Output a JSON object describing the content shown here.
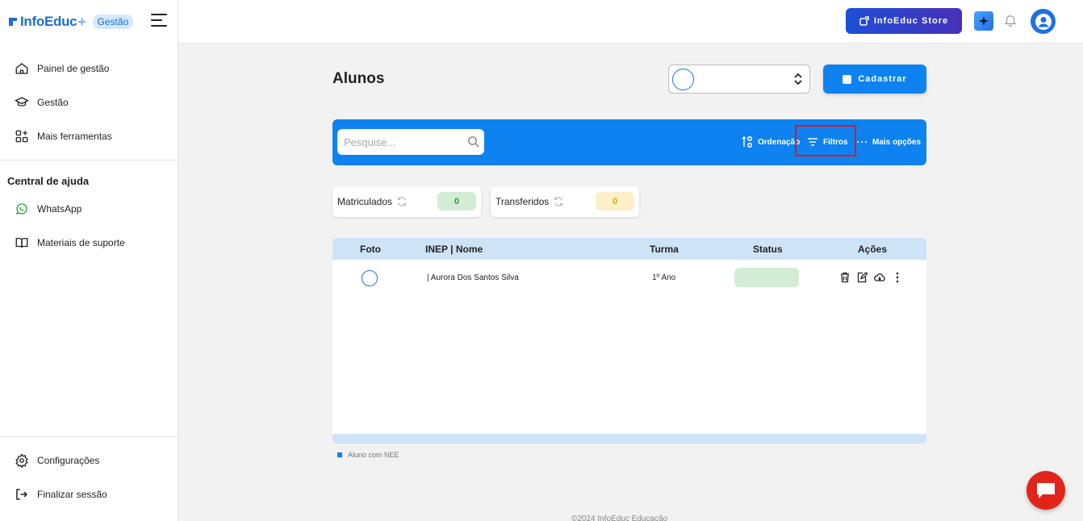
{
  "brand": {
    "name": "InfoEduc",
    "badge": "Gestão"
  },
  "sidebar": {
    "items": [
      {
        "label": "Painel de gestão",
        "icon": "home-icon"
      },
      {
        "label": "Gestão",
        "icon": "graduation-cap-icon"
      },
      {
        "label": "Mais ferramentas",
        "icon": "apps-icon"
      }
    ],
    "help_title": "Central de ajuda",
    "help_items": [
      {
        "label": "WhatsApp",
        "icon": "whatsapp-icon"
      },
      {
        "label": "Materiais de suporte",
        "icon": "book-icon"
      }
    ],
    "bottom_items": [
      {
        "label": "Configurações",
        "icon": "gear-icon"
      },
      {
        "label": "Finalizar sessão",
        "icon": "logout-icon"
      }
    ]
  },
  "topbar": {
    "store_label": "InfoEduc Store"
  },
  "page": {
    "title": "Alunos",
    "cadastrar_label": "Cadastrar"
  },
  "toolbar": {
    "search_placeholder": "Pesquise...",
    "ordenacao": "Ordenação",
    "filtros": "Filtros",
    "mais_opcoes": "Mais opções"
  },
  "stats": {
    "matriculados": {
      "label": "Matriculados",
      "value": "0"
    },
    "transferidos": {
      "label": "Transferidos",
      "value": "0"
    }
  },
  "table": {
    "columns": [
      "Foto",
      "INEP | Nome",
      "Turma",
      "Status",
      "Ações"
    ],
    "rows": [
      {
        "nome": "| Aurora Dos Santos Silva",
        "turma": "1º Ano",
        "status": ""
      }
    ]
  },
  "legend": {
    "label": "Aluno com NEE"
  },
  "footer": {
    "text": "©2024 InfoEduc Educação"
  },
  "colors": {
    "primary": "#0d82f0",
    "brand": "#1a6fd6",
    "danger": "#e1251b",
    "green_pill": "#d3ecd6",
    "yellow_pill": "#fdf0c9"
  }
}
